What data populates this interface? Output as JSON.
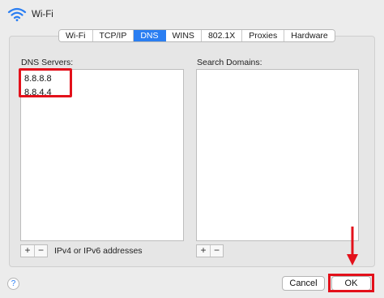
{
  "window": {
    "title": "Wi-Fi"
  },
  "tabs": [
    {
      "label": "Wi-Fi",
      "active": false
    },
    {
      "label": "TCP/IP",
      "active": false
    },
    {
      "label": "DNS",
      "active": true
    },
    {
      "label": "WINS",
      "active": false
    },
    {
      "label": "802.1X",
      "active": false
    },
    {
      "label": "Proxies",
      "active": false
    },
    {
      "label": "Hardware",
      "active": false
    }
  ],
  "dns_servers": {
    "label": "DNS Servers:",
    "entries": [
      "8.8.8.8",
      "8.8.4.4"
    ],
    "add_label": "+",
    "remove_label": "−",
    "hint": "IPv4 or IPv6 addresses"
  },
  "search_domains": {
    "label": "Search Domains:",
    "add_label": "+",
    "remove_label": "−"
  },
  "footer": {
    "help_label": "?",
    "cancel_label": "Cancel",
    "ok_label": "OK"
  },
  "colors": {
    "accent": "#2a7ef2",
    "annotation_red": "#e3111b"
  },
  "icons": {
    "header": "wifi-icon",
    "help": "help-icon",
    "annotation_arrow": "down-arrow-icon"
  }
}
